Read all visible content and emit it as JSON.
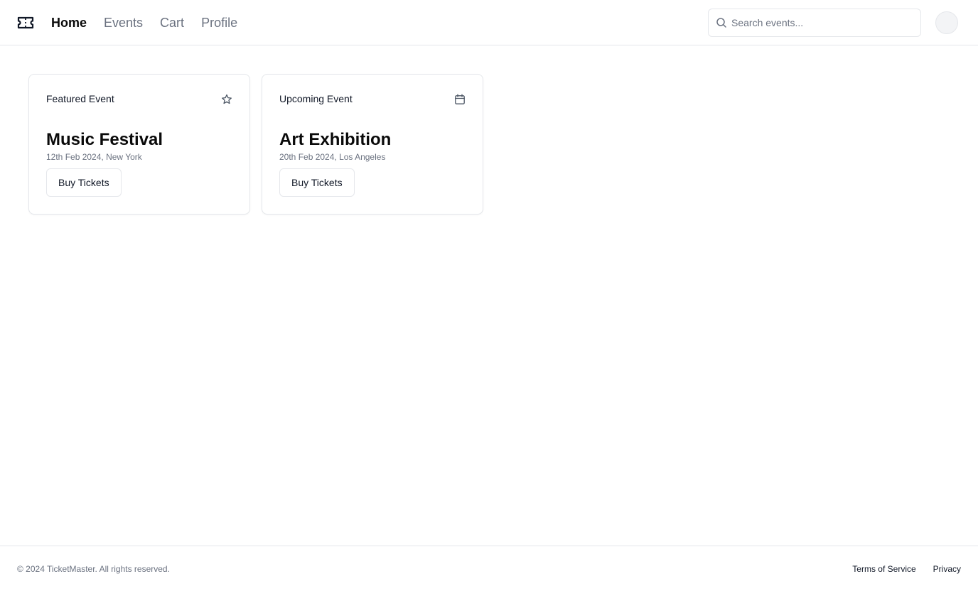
{
  "header": {
    "logo_icon": "ticket-icon",
    "nav": [
      {
        "label": "Home",
        "active": true
      },
      {
        "label": "Events",
        "active": false
      },
      {
        "label": "Cart",
        "active": false
      },
      {
        "label": "Profile",
        "active": false
      }
    ],
    "search": {
      "icon": "search-icon",
      "placeholder": "Search events...",
      "value": ""
    }
  },
  "cards": [
    {
      "tag": "Featured Event",
      "icon": "star-icon",
      "title": "Music Festival",
      "meta": "12th Feb 2024, New York",
      "button_label": "Buy Tickets"
    },
    {
      "tag": "Upcoming Event",
      "icon": "calendar-icon",
      "title": "Art Exhibition",
      "meta": "20th Feb 2024, Los Angeles",
      "button_label": "Buy Tickets"
    }
  ],
  "footer": {
    "copyright": "© 2024 TicketMaster. All rights reserved.",
    "links": [
      "Terms of Service",
      "Privacy"
    ]
  },
  "colors": {
    "text_primary": "#0a0a0a",
    "text_muted": "#6b7280",
    "border": "#e5e7eb"
  }
}
